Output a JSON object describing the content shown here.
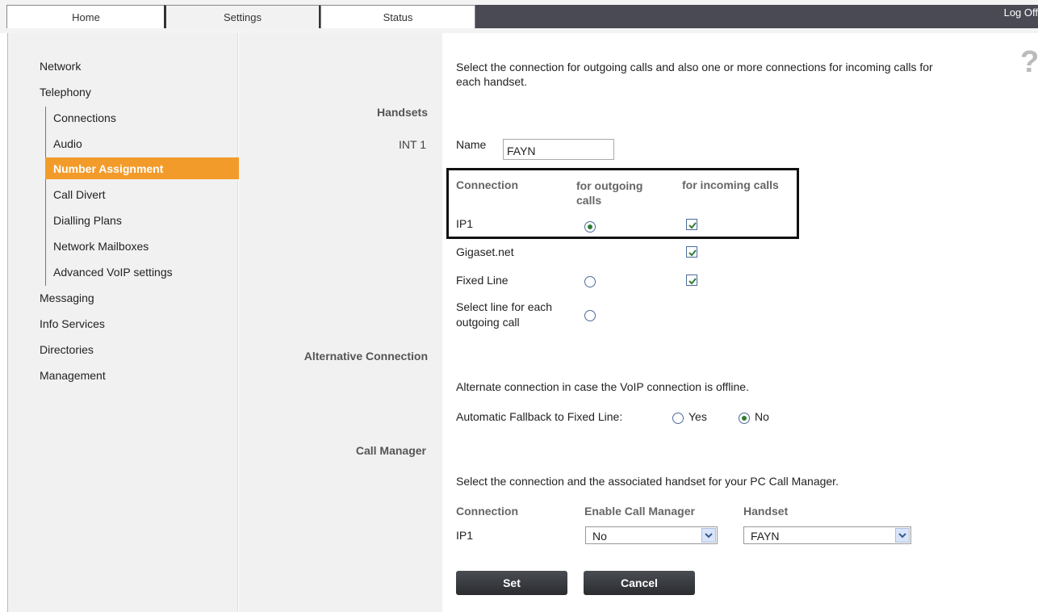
{
  "tabs": {
    "home": "Home",
    "settings": "Settings",
    "status": "Status"
  },
  "logout": "Log Off",
  "help_symbol": "?",
  "sidebar": {
    "network": "Network",
    "telephony": "Telephony",
    "connections": "Connections",
    "audio": "Audio",
    "number_assignment": "Number Assignment",
    "call_divert": "Call Divert",
    "dialling_plans": "Dialling Plans",
    "network_mailboxes": "Network Mailboxes",
    "advanced_voip": "Advanced VoIP settings",
    "messaging": "Messaging",
    "info_services": "Info Services",
    "directories": "Directories",
    "management": "Management"
  },
  "intro": "Select the connection for outgoing calls and also one or more connections for incoming calls for each handset.",
  "handsets": {
    "section_label": "Handsets",
    "int_label": "INT 1",
    "name_label": "Name",
    "name_value": "FAYN",
    "col_connection": "Connection",
    "col_outgoing": "for outgoing calls",
    "col_incoming": "for incoming calls",
    "rows": [
      {
        "label": "IP1",
        "outgoing": true,
        "incoming": true,
        "has_radio": true
      },
      {
        "label": "Gigaset.net",
        "outgoing": false,
        "incoming": true,
        "has_radio": false
      },
      {
        "label": "Fixed Line",
        "outgoing": false,
        "incoming": true,
        "has_radio": true
      },
      {
        "label": "Select line for each outgoing call",
        "outgoing": false,
        "incoming": false,
        "has_radio": true
      }
    ]
  },
  "alternative": {
    "section_label": "Alternative Connection",
    "description": "Alternate connection in case the VoIP connection is offline.",
    "fallback_label": "Automatic Fallback to Fixed Line:",
    "yes": "Yes",
    "no": "No",
    "selected": "No"
  },
  "call_manager": {
    "section_label": "Call Manager",
    "description": "Select the connection and the associated handset for your PC Call Manager.",
    "col_connection": "Connection",
    "col_enable": "Enable Call Manager",
    "col_handset": "Handset",
    "connection_value": "IP1",
    "enable_value": "No",
    "handset_value": "FAYN"
  },
  "buttons": {
    "set": "Set",
    "cancel": "Cancel"
  },
  "colors": {
    "accent": "#f39b2a",
    "topbar_dark": "#4a4a55",
    "check_green": "#2e7d32"
  }
}
